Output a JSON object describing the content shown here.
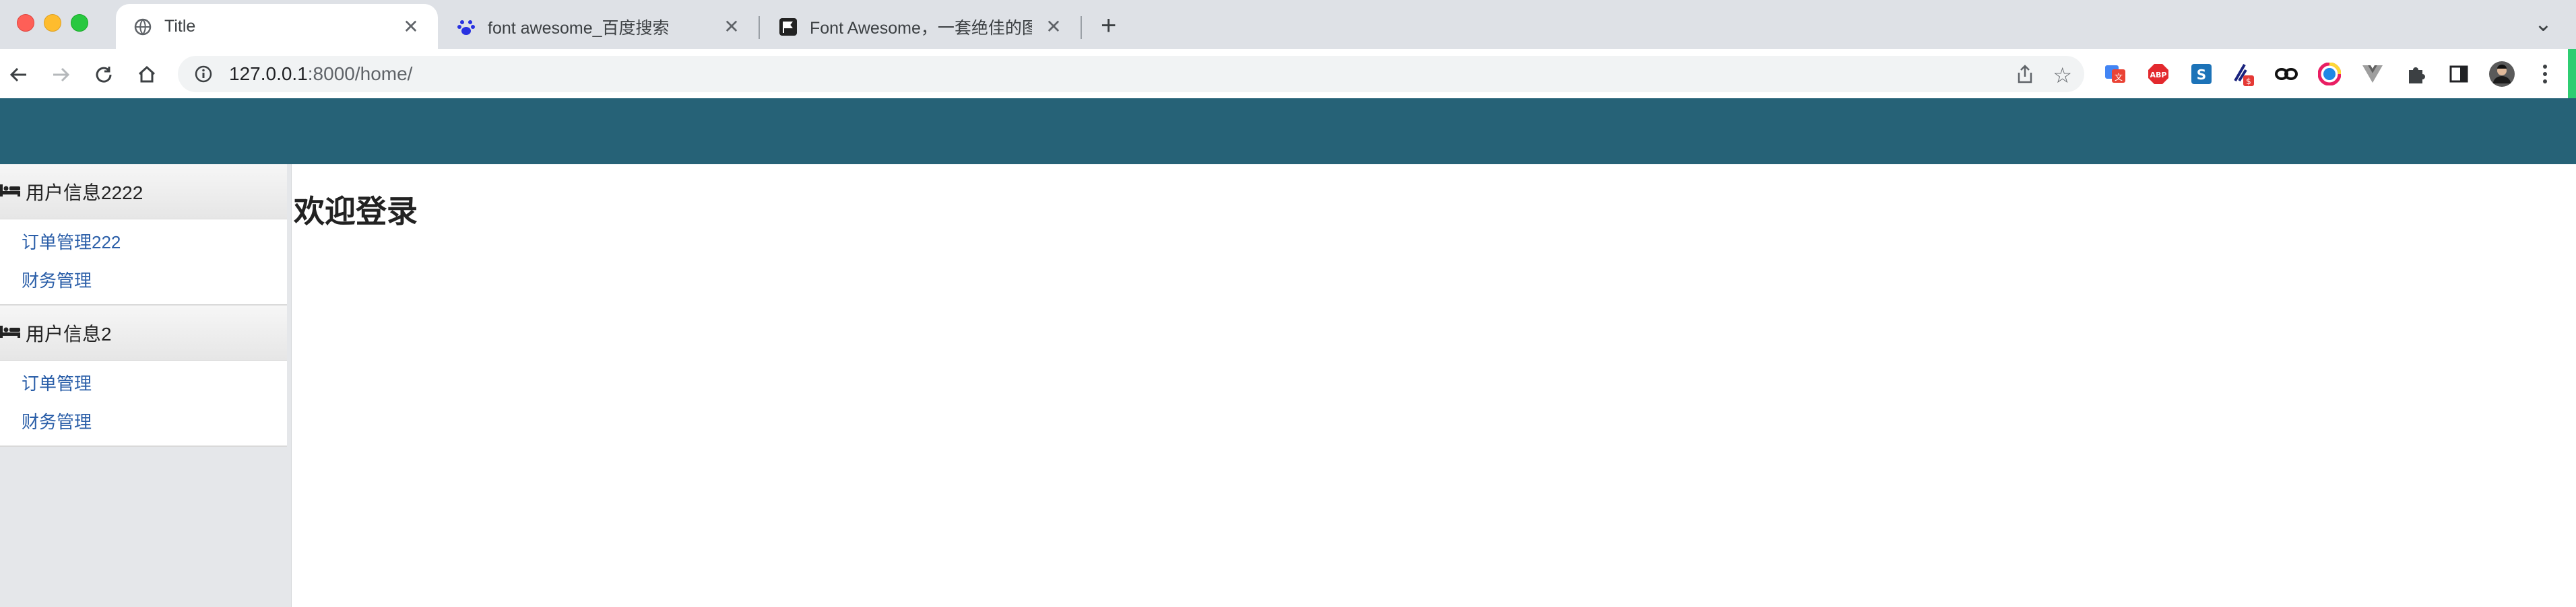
{
  "browser": {
    "tabs": [
      {
        "title": "Title",
        "icon": "globe-icon",
        "active": true
      },
      {
        "title": "font awesome_百度搜索",
        "icon": "baidu-paw-icon",
        "active": false
      },
      {
        "title": "Font Awesome，一套绝佳的图标",
        "icon": "flag-icon",
        "active": false
      }
    ],
    "url": {
      "host": "127.0.0.1",
      "path": ":8000/home/"
    },
    "extensions": [
      "google-translate-icon",
      "adblock-plus-icon",
      "sider-icon",
      "tampermonkey-icon",
      "link-icon",
      "color-picker-icon",
      "vue-devtools-icon",
      "puzzle-extensions-icon",
      "side-panel-icon",
      "profile-avatar-icon",
      "kebab-menu-icon"
    ],
    "colors": {
      "tabbar": "#dee1e6",
      "accent_green": "#2fcd72"
    }
  },
  "page": {
    "header_color": "#266277",
    "menu": [
      {
        "title": "用户信息2222",
        "icon": "bed-icon",
        "items": [
          "订单管理222",
          "财务管理"
        ]
      },
      {
        "title": "用户信息2",
        "icon": "bed-icon",
        "items": [
          "订单管理",
          "财务管理"
        ]
      }
    ],
    "heading": "欢迎登录"
  }
}
